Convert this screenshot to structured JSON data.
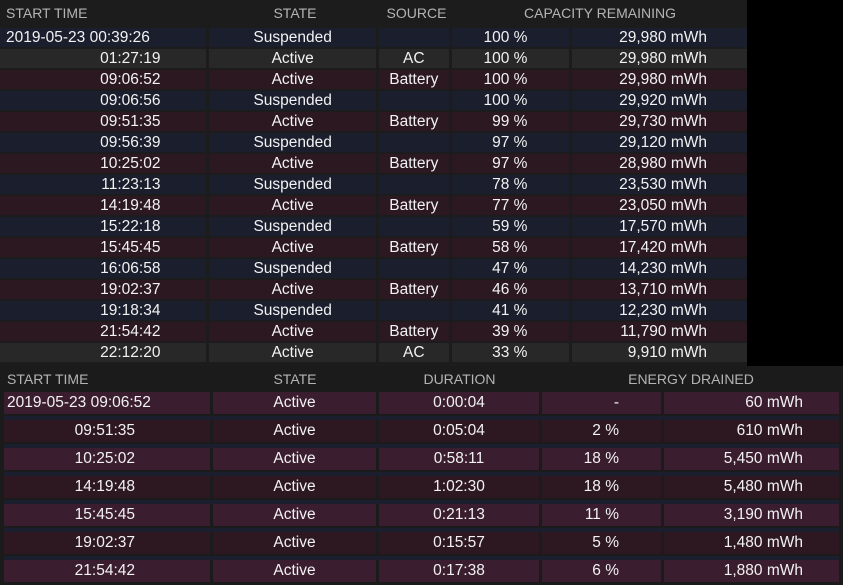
{
  "sessions": {
    "headers": [
      "START TIME",
      "STATE",
      "SOURCE",
      "CAPACITY REMAINING"
    ],
    "rows": [
      {
        "time": "2019-05-23 00:39:26",
        "state": "Suspended",
        "source": "",
        "percent": "100 %",
        "capacity": "29,980 mWh"
      },
      {
        "time": "01:27:19",
        "state": "Active",
        "source": "AC",
        "percent": "100 %",
        "capacity": "29,980 mWh"
      },
      {
        "time": "09:06:52",
        "state": "Active",
        "source": "Battery",
        "percent": "100 %",
        "capacity": "29,980 mWh"
      },
      {
        "time": "09:06:56",
        "state": "Suspended",
        "source": "",
        "percent": "100 %",
        "capacity": "29,920 mWh"
      },
      {
        "time": "09:51:35",
        "state": "Active",
        "source": "Battery",
        "percent": "99 %",
        "capacity": "29,730 mWh"
      },
      {
        "time": "09:56:39",
        "state": "Suspended",
        "source": "",
        "percent": "97 %",
        "capacity": "29,120 mWh"
      },
      {
        "time": "10:25:02",
        "state": "Active",
        "source": "Battery",
        "percent": "97 %",
        "capacity": "28,980 mWh"
      },
      {
        "time": "11:23:13",
        "state": "Suspended",
        "source": "",
        "percent": "78 %",
        "capacity": "23,530 mWh"
      },
      {
        "time": "14:19:48",
        "state": "Active",
        "source": "Battery",
        "percent": "77 %",
        "capacity": "23,050 mWh"
      },
      {
        "time": "15:22:18",
        "state": "Suspended",
        "source": "",
        "percent": "59 %",
        "capacity": "17,570 mWh"
      },
      {
        "time": "15:45:45",
        "state": "Active",
        "source": "Battery",
        "percent": "58 %",
        "capacity": "17,420 mWh"
      },
      {
        "time": "16:06:58",
        "state": "Suspended",
        "source": "",
        "percent": "47 %",
        "capacity": "14,230 mWh"
      },
      {
        "time": "19:02:37",
        "state": "Active",
        "source": "Battery",
        "percent": "46 %",
        "capacity": "13,710 mWh"
      },
      {
        "time": "19:18:34",
        "state": "Suspended",
        "source": "",
        "percent": "41 %",
        "capacity": "12,230 mWh"
      },
      {
        "time": "21:54:42",
        "state": "Active",
        "source": "Battery",
        "percent": "39 %",
        "capacity": "11,790 mWh"
      },
      {
        "time": "22:12:20",
        "state": "Active",
        "source": "AC",
        "percent": "33 %",
        "capacity": "9,910 mWh"
      }
    ]
  },
  "usage": {
    "headers": [
      "START TIME",
      "STATE",
      "DURATION",
      "ENERGY DRAINED"
    ],
    "rows": [
      {
        "time": "2019-05-23 09:06:52",
        "state": "Active",
        "duration": "0:00:04",
        "percent": "-",
        "energy": "60 mWh"
      },
      {
        "time": "09:51:35",
        "state": "Active",
        "duration": "0:05:04",
        "percent": "2 %",
        "energy": "610 mWh"
      },
      {
        "time": "10:25:02",
        "state": "Active",
        "duration": "0:58:11",
        "percent": "18 %",
        "energy": "5,450 mWh"
      },
      {
        "time": "14:19:48",
        "state": "Active",
        "duration": "1:02:30",
        "percent": "18 %",
        "energy": "5,480 mWh"
      },
      {
        "time": "15:45:45",
        "state": "Active",
        "duration": "0:21:13",
        "percent": "11 %",
        "energy": "3,190 mWh"
      },
      {
        "time": "19:02:37",
        "state": "Active",
        "duration": "0:15:57",
        "percent": "5 %",
        "energy": "1,480 mWh"
      },
      {
        "time": "21:54:42",
        "state": "Active",
        "duration": "0:17:38",
        "percent": "6 %",
        "energy": "1,880 mWh"
      }
    ]
  }
}
